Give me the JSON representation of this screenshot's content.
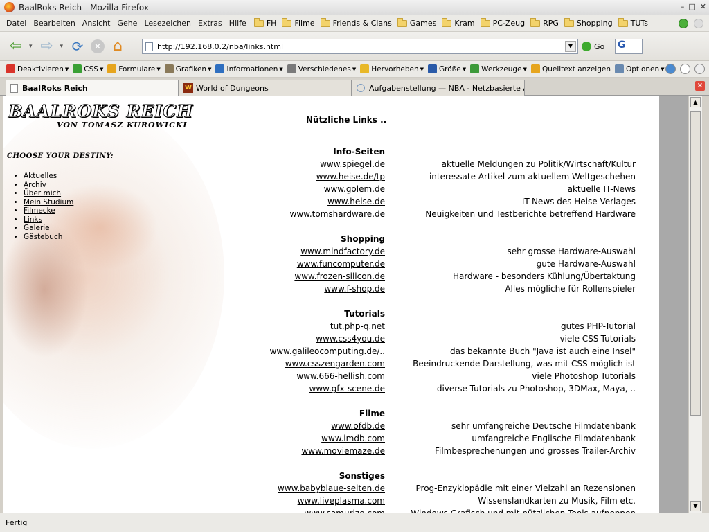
{
  "window": {
    "title": "BaalRoks Reich - Mozilla Firefox",
    "controls": [
      "–",
      "□",
      "✕"
    ]
  },
  "menubar": {
    "items": [
      "Datei",
      "Bearbeiten",
      "Ansicht",
      "Gehe",
      "Lesezeichen",
      "Extras",
      "Hilfe"
    ],
    "bookmarks": [
      "FH",
      "Filme",
      "Friends & Clans",
      "Games",
      "Kram",
      "PC-Zeug",
      "RPG",
      "Shopping",
      "TUTs"
    ]
  },
  "navbar": {
    "url": "http://192.168.0.2/nba/links.html",
    "go_label": "Go",
    "search_glyph": "G"
  },
  "toolbar": {
    "items": [
      {
        "label": "Deaktivieren",
        "color": "#d9342b"
      },
      {
        "label": "CSS",
        "color": "#3aa035"
      },
      {
        "label": "Formulare",
        "color": "#e6a51e"
      },
      {
        "label": "Grafiken",
        "color": "#8a7a5a"
      },
      {
        "label": "Informationen",
        "color": "#2f6fc0"
      },
      {
        "label": "Verschiedenes",
        "color": "#7a7a7a"
      },
      {
        "label": "Hervorheben",
        "color": "#e8b828"
      },
      {
        "label": "Größe",
        "color": "#2a5aa8"
      },
      {
        "label": "Werkzeuge",
        "color": "#3d9a3a"
      },
      {
        "label": "Quelltext anzeigen",
        "color": "#e6a51e",
        "no_dropdown": true
      },
      {
        "label": "Optionen",
        "color": "#6a8ab0"
      }
    ]
  },
  "tabs": [
    {
      "label": "BaalRoks Reich",
      "active": true
    },
    {
      "label": "World of Dungeons",
      "icon_text": "W"
    },
    {
      "label": "Aufgabenstellung — NBA - Netzbasierte An..."
    }
  ],
  "site": {
    "logo_title": "BAALROKS REICH",
    "logo_subtitle": "VON TOMASZ KUROWICKI",
    "destiny_label": "CHOOSE YOUR DESTINY:",
    "nav": [
      "Aktuelles",
      "Archiv",
      "Über mich",
      "Mein Studium",
      "Filmecke",
      "Links",
      "Galerie",
      "Gästebuch"
    ]
  },
  "content": {
    "heading": "Nützliche Links ..",
    "sections": [
      {
        "title": "Info-Seiten",
        "links": [
          {
            "url": "www.spiegel.de",
            "desc": "aktuelle Meldungen zu Politik/Wirtschaft/Kultur"
          },
          {
            "url": "www.heise.de/tp",
            "desc": "interessate Artikel zum aktuellem Weltgeschehen"
          },
          {
            "url": "www.golem.de",
            "desc": "aktuelle IT-News"
          },
          {
            "url": "www.heise.de",
            "desc": "IT-News des Heise Verlages"
          },
          {
            "url": "www.tomshardware.de",
            "desc": "Neuigkeiten und Testberichte betreffend Hardware"
          }
        ]
      },
      {
        "title": "Shopping",
        "links": [
          {
            "url": "www.mindfactory.de",
            "desc": "sehr grosse Hardware-Auswahl"
          },
          {
            "url": "www.funcomputer.de",
            "desc": "gute Hardware-Auswahl"
          },
          {
            "url": "www.frozen-silicon.de",
            "desc": "Hardware - besonders Kühlung/Übertaktung"
          },
          {
            "url": "www.f-shop.de",
            "desc": "Alles mögliche für Rollenspieler"
          }
        ]
      },
      {
        "title": "Tutorials",
        "links": [
          {
            "url": "tut.php-q.net",
            "desc": "gutes PHP-Tutorial"
          },
          {
            "url": "www.css4you.de",
            "desc": "viele CSS-Tutorials"
          },
          {
            "url": "www.galileocomputing.de/..",
            "desc": "das bekannte Buch \"Java ist auch eine Insel\""
          },
          {
            "url": "www.csszengarden.com",
            "desc": "Beeindruckende Darstellung, was mit CSS möglich ist"
          },
          {
            "url": "www.666-hellish.com",
            "desc": "viele Photoshop Tutorials"
          },
          {
            "url": "www.gfx-scene.de",
            "desc": "diverse Tutorials zu Photoshop, 3DMax, Maya, .."
          }
        ]
      },
      {
        "title": "Filme",
        "links": [
          {
            "url": "www.ofdb.de",
            "desc": "sehr umfangreiche Deutsche Filmdatenbank"
          },
          {
            "url": "www.imdb.com",
            "desc": "umfangreiche Englische Filmdatenbank"
          },
          {
            "url": "www.moviemaze.de",
            "desc": "Filmbesprechenungen und grosses Trailer-Archiv"
          }
        ]
      },
      {
        "title": "Sonstiges",
        "links": [
          {
            "url": "www.babyblaue-seiten.de",
            "desc": "Prog-Enzyklopädie mit einer Vielzahl an Rezensionen"
          },
          {
            "url": "www.liveplasma.com",
            "desc": "Wissenslandkarten zu Musik, Film etc."
          },
          {
            "url": "www.samurize.com",
            "desc": "Windows Grafisch und mit nützlichen Tools aufpeppen"
          }
        ]
      }
    ]
  },
  "status": {
    "text": "Fertig"
  }
}
